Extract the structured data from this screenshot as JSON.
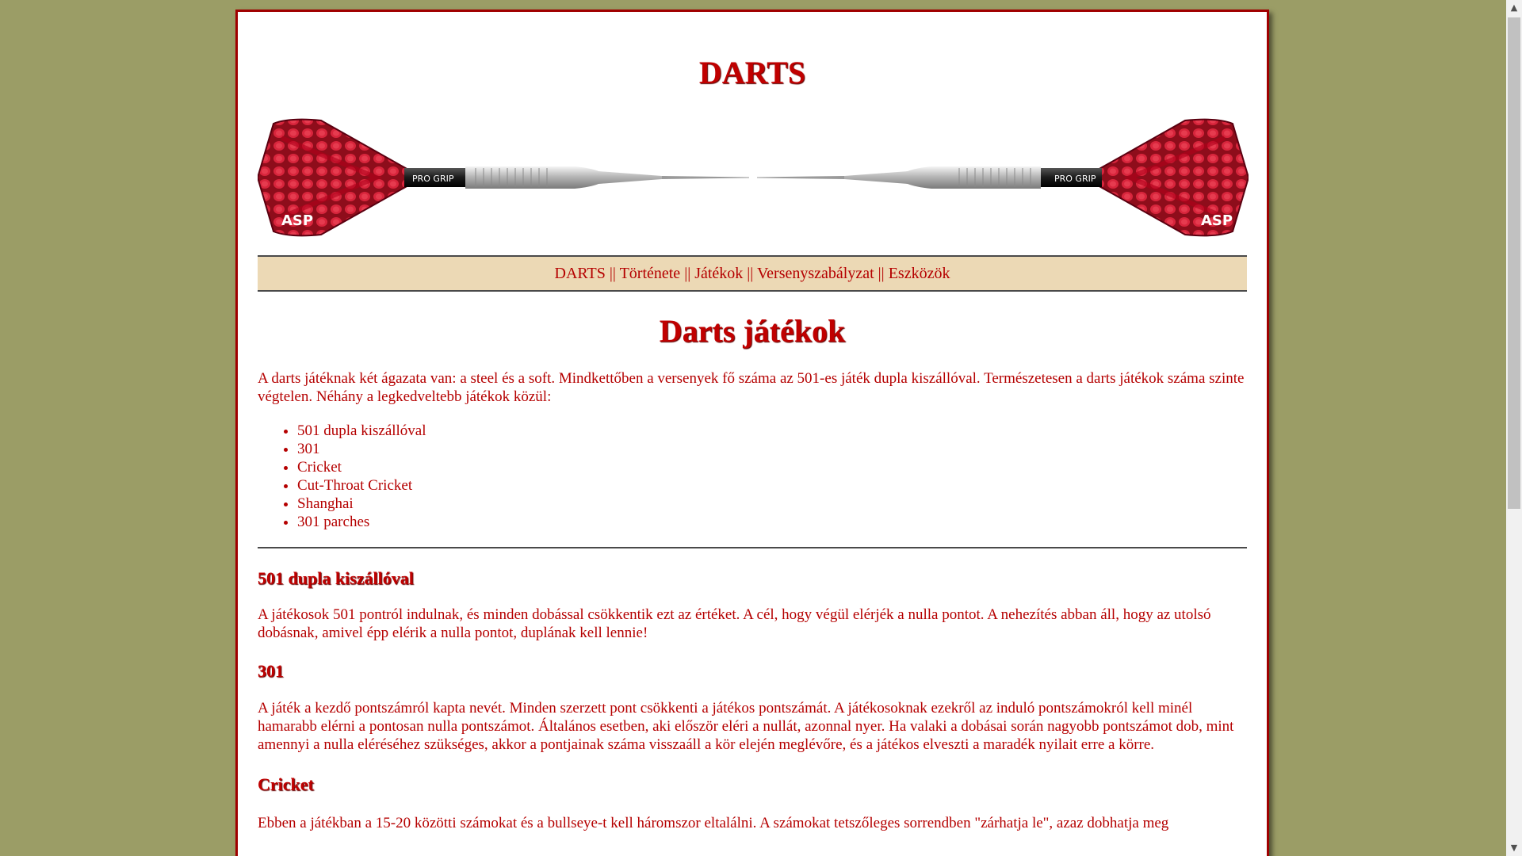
{
  "site": {
    "title": "DARTS"
  },
  "nav": {
    "items": [
      {
        "label": "DARTS"
      },
      {
        "label": "Története"
      },
      {
        "label": "Játékok"
      },
      {
        "label": "Versenyszabályzat"
      },
      {
        "label": "Eszközök"
      }
    ],
    "separator": "||"
  },
  "banner": {
    "left_label": "ASP",
    "right_label": "ASP",
    "grip_label": "PRO GRIP"
  },
  "main": {
    "heading": "Darts játékok",
    "intro": "A darts játéknak két ágazata van: a steel és a soft. Mindkettőben a versenyek fő száma az 501-es játék dupla kiszállóval. Természetesen a darts játékok száma szinte végtelen. Néhány a legkedveltebb játékok közül:",
    "games": [
      "501 dupla kiszállóval",
      "301",
      "Cricket",
      "Cut-Throat Cricket",
      "Shanghai",
      "301 parches"
    ],
    "sections": [
      {
        "title": "501 dupla kiszállóval",
        "text": "A játékosok 501 pontról indulnak, és minden dobással csökkentik ezt az értéket. A cél, hogy végül elérjék a nulla pontot. A nehezítés abban áll, hogy az utolsó dobásnak, amivel épp elérik a nulla pontot, duplának kell lennie!"
      },
      {
        "title": "301",
        "text": "A játék a kezdő pontszámról kapta nevét. Minden szerzett pont csökkenti a játékos pontszámát. A játékosoknak ezekről az induló pontszámokról kell minél hamarabb elérni a pontosan nulla pontszámot. Általános esetben, aki először eléri a nullát, azonnal nyer. Ha valaki a dobásai során nagyobb pontszámot dob, mint amennyi a nulla eléréséhez szükséges, akkor a pontjainak száma visszaáll a kör elején meglévőre, és a játékos elveszti a maradék nyilait erre a körre."
      },
      {
        "title": "Cricket",
        "text": "Ebben a játékban a 15-20 közötti számokat és a bullseye-t kell háromszor eltalálni. A számokat tetszőleges sorrendben \"zárhatja le\", azaz dobhatja meg"
      }
    ]
  },
  "colors": {
    "background": "#9b9d66",
    "text": "#b50000",
    "nav_bg": "#ecd9b5",
    "flight_red": "#c8102e"
  }
}
